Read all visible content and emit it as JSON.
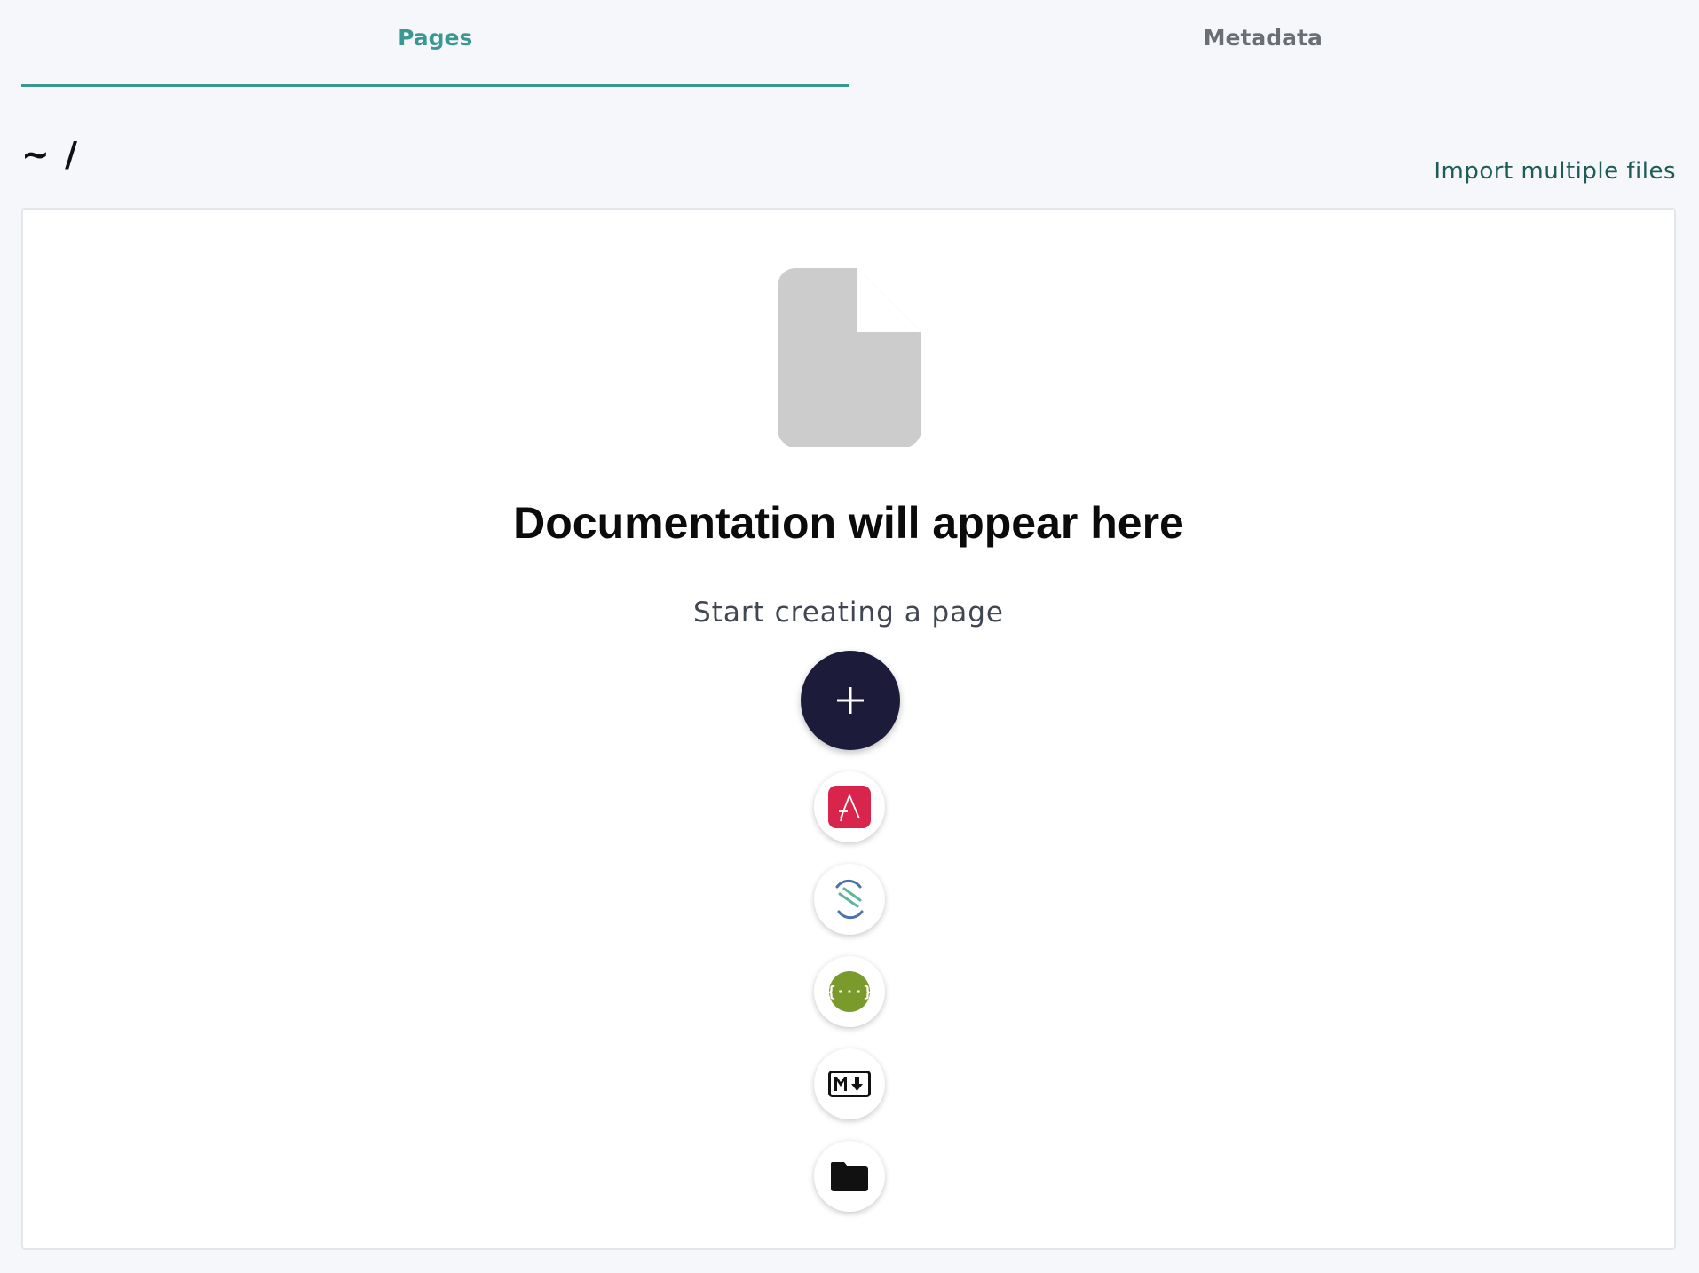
{
  "tabs": [
    {
      "label": "Pages",
      "active": true
    },
    {
      "label": "Metadata",
      "active": false
    }
  ],
  "breadcrumb": "~ /",
  "import_link": "Import multiple files",
  "empty_state": {
    "title": "Documentation will appear here",
    "subtitle": "Start creating a page"
  },
  "actions": {
    "add_icon": "plus-icon",
    "import_options": [
      {
        "icon": "asyncapi-icon",
        "color": "#d9254b"
      },
      {
        "icon": "stoplight-icon",
        "color": "#4d70b0"
      },
      {
        "icon": "swagger-icon",
        "color": "#7a9a2b"
      },
      {
        "icon": "markdown-icon",
        "color": "#111111"
      },
      {
        "icon": "folder-icon",
        "color": "#111111"
      }
    ]
  },
  "colors": {
    "accent": "#3a9893",
    "background": "#f5f7fb",
    "fab": "#1c1c3a",
    "doc_icon": "#cccccc"
  }
}
